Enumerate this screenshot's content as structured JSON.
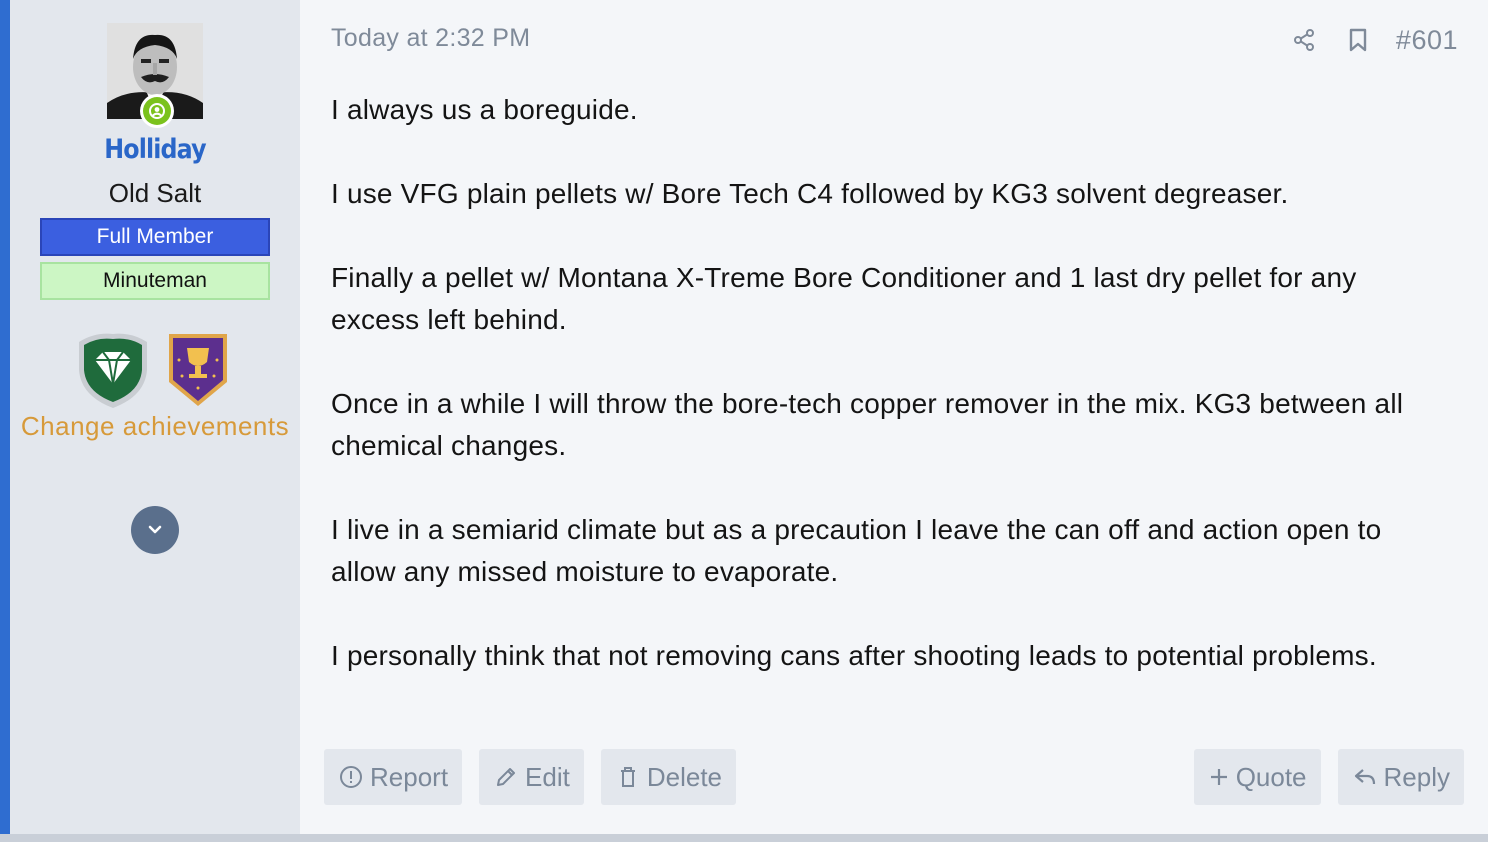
{
  "post": {
    "timestamp": "Today at 2:32 PM",
    "number": "#601",
    "paragraphs": [
      "I always us a boreguide.",
      "I use VFG plain pellets w/ Bore Tech C4 followed by KG3 solvent degreaser.",
      "Finally a pellet w/ Montana X-Treme Bore Conditioner and 1 last dry pellet for any excess left behind.",
      "Once in a while I will throw the bore-tech copper remover in the mix. KG3 between all chemical changes.",
      "I live in a semiarid climate but as a precaution I leave the can off and action open to allow any missed moisture to evaporate.",
      "I personally think that not removing cans after shooting leads to potential problems."
    ]
  },
  "author": {
    "username": "Holliday",
    "title": "Old Salt",
    "banners": [
      "Full Member",
      "Minuteman"
    ],
    "change_achievements": "Change achievements",
    "online": true
  },
  "actions": {
    "report": "Report",
    "edit": "Edit",
    "delete": "Delete",
    "quote": "Quote",
    "reply": "Reply"
  },
  "colors": {
    "accent": "#2f6dd0",
    "username": "#2a66c8",
    "full_member_banner": "#3b5fe0",
    "minuteman_banner": "#ccf6c4",
    "achievement_link": "#d79a3a",
    "online": "#7bc21d"
  },
  "icons": [
    "share-icon",
    "bookmark-icon",
    "report-icon",
    "edit-icon",
    "delete-icon",
    "plus-icon",
    "reply-icon",
    "chevron-down-icon",
    "diamond-trophy-icon",
    "cup-trophy-icon",
    "online-user-icon"
  ]
}
